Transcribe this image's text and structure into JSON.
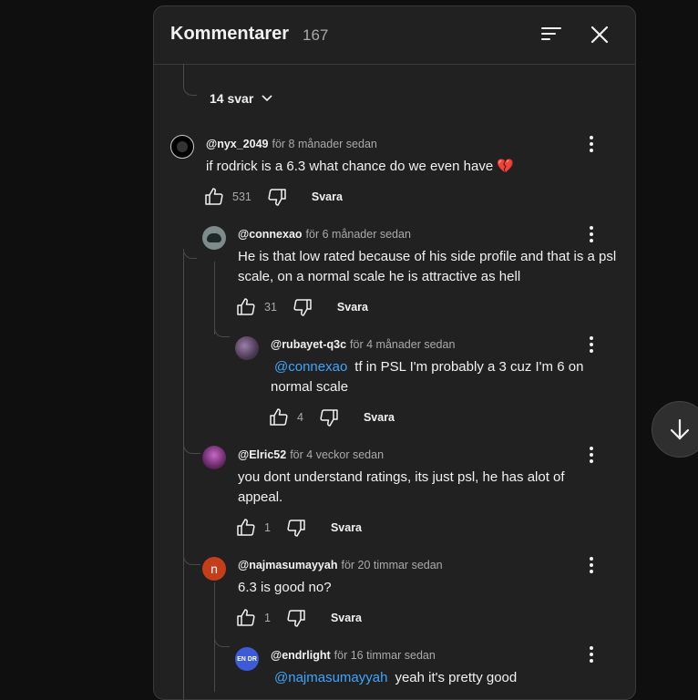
{
  "header": {
    "title": "Kommentarer",
    "count": "167",
    "sort_icon": "sort-icon",
    "close_icon": "close-icon"
  },
  "replies_toggle": {
    "label": "14 svar"
  },
  "reply_label": "Svara",
  "comments": [
    {
      "handle": "@nyx_2049",
      "time": "för 8 månader sedan",
      "text": "if rodrick is a 6.3 what chance do we even have 💔",
      "likes": "531"
    },
    {
      "handle": "@connexao",
      "time": "för 6 månader sedan",
      "text": "He is that low rated because of his side profile and that is a psl scale, on a normal scale he is attractive as hell",
      "likes": "31"
    },
    {
      "handle": "@rubayet-q3c",
      "time": "för 4 månader sedan",
      "mention": "@connexao",
      "text": "tf in PSL I'm probably a 3 cuz I'm 6 on normal scale",
      "likes": "4"
    },
    {
      "handle": "@Elric52",
      "time": "för 4 veckor sedan",
      "text": "you dont understand ratings, its just psl, he has alot of appeal.",
      "likes": "1"
    },
    {
      "handle": "@najmasumayyah",
      "time": "för 20 timmar sedan",
      "text": "6.3 is good no?",
      "likes": "1",
      "avatar_letter": "n",
      "avatar_color": "#c53e1c"
    },
    {
      "handle": "@endrlight",
      "time": "för 16 timmar sedan",
      "mention": "@najmasumayyah",
      "text": "yeah it's pretty good",
      "avatar_letter": "EN DR",
      "avatar_color": "#3d5bd6"
    }
  ],
  "colors": {
    "accent_link": "#3ea6ff",
    "panel_bg": "#212121",
    "page_bg": "#0f0f0f"
  }
}
